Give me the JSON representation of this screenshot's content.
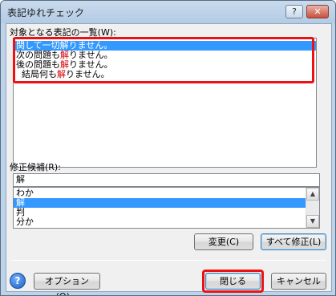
{
  "window": {
    "title": "表記ゆれチェック",
    "help_glyph": "?",
    "close_glyph": "✕"
  },
  "variants_list": {
    "label": "対象となる表記の一覧(W):",
    "items": [
      {
        "before": "関して一切",
        "hl": "解",
        "after": "りません。",
        "selected": true
      },
      {
        "before": "次の問題も",
        "hl": "解",
        "after": "りません。",
        "selected": false
      },
      {
        "before": "後の問題も",
        "hl": "解",
        "after": "りません。",
        "selected": false
      },
      {
        "before": "  結局何も",
        "hl": "解",
        "after": "りません。",
        "selected": false
      }
    ]
  },
  "candidates": {
    "label": "修正候補(R):",
    "input_value": "解",
    "items": [
      "わか",
      "解",
      "判",
      "分か"
    ],
    "selected_index": 1
  },
  "buttons": {
    "change": "変更(C)",
    "change_all": "すべて修正(L)",
    "options": "オプション(O)...",
    "close": "閉じる",
    "cancel": "キャンセル"
  },
  "icons": {
    "help": "help-icon",
    "scroll_up": "chevron-up-icon",
    "scroll_down": "chevron-down-icon"
  },
  "colors": {
    "highlight_char": "#d40000",
    "selection": "#3399ff",
    "annotation_box": "#ee1111"
  }
}
